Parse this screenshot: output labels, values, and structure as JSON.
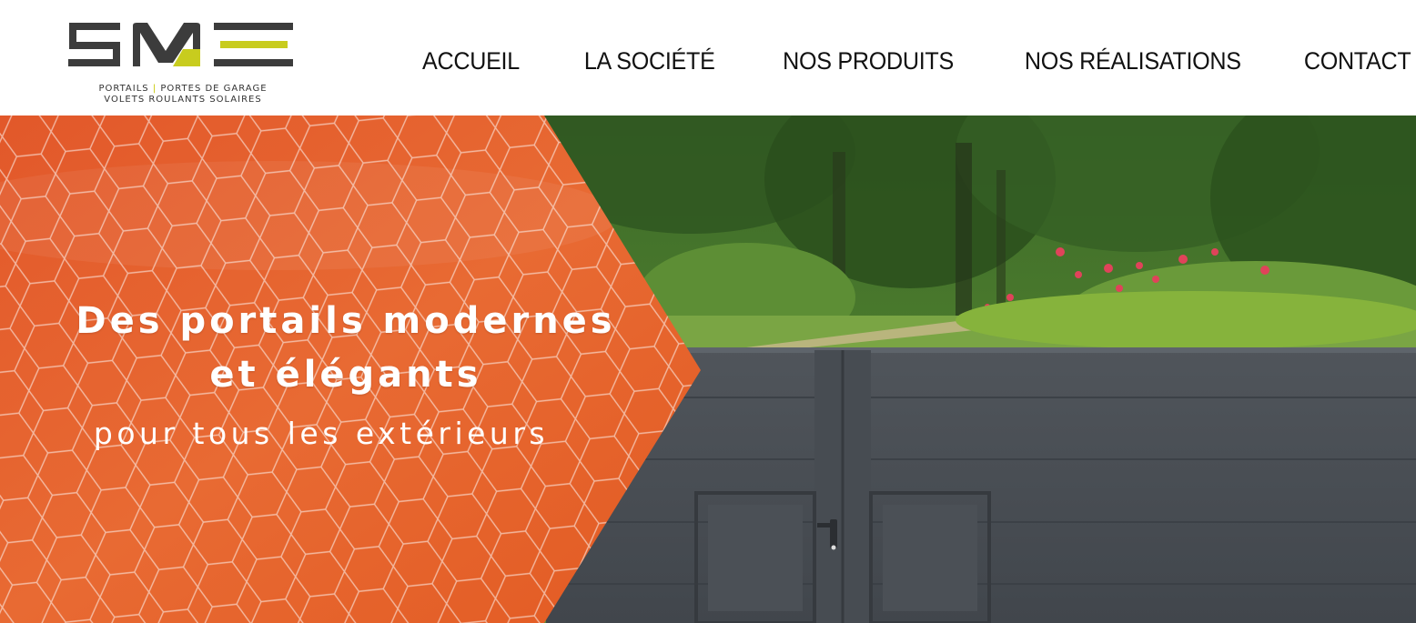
{
  "brand": {
    "tagline_line1_a": "PORTAILS",
    "tagline_separator": "|",
    "tagline_line1_b": "PORTES DE GARAGE",
    "tagline_line2": "VOLETS ROULANTS SOLAIRES",
    "colors": {
      "dark": "#3a3a3a",
      "accent": "#c8cc1e"
    }
  },
  "nav": {
    "items": [
      {
        "label": "ACCUEIL"
      },
      {
        "label": "LA SOCIÉTÉ"
      },
      {
        "label": "NOS PRODUITS"
      },
      {
        "label": "NOS RÉALISATIONS"
      },
      {
        "label": "CONTACT"
      }
    ]
  },
  "hero": {
    "title_line1": "Des portails modernes",
    "title_line2": "et élégants",
    "subtitle": "pour tous les extérieurs",
    "colors": {
      "orange": "#e05a23",
      "gate": "#4a4f55"
    }
  }
}
